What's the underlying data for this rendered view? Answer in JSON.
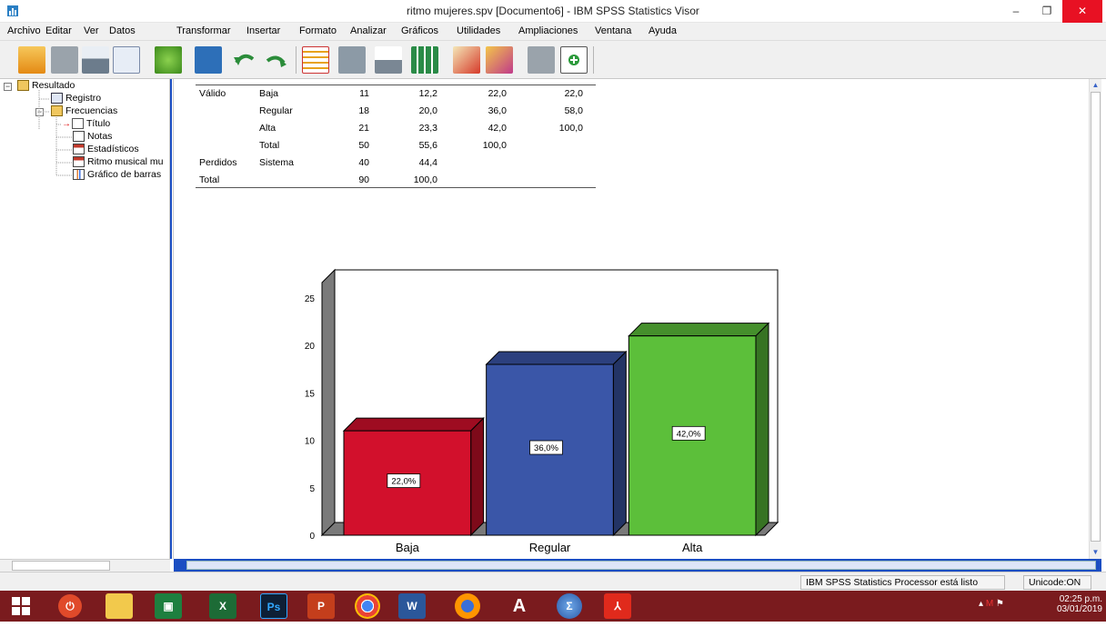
{
  "window": {
    "title": "ritmo mujeres.spv [Documento6] - IBM SPSS Statistics Visor",
    "minimize": "–",
    "restore": "❐",
    "close": "✕"
  },
  "menu": [
    "Archivo",
    "Editar",
    "Ver",
    "Datos",
    "Transformar",
    "Insertar",
    "Formato",
    "Analizar",
    "Gráficos",
    "Utilidades",
    "Ampliaciones",
    "Ventana",
    "Ayuda"
  ],
  "toolbar_icons": [
    "open-icon",
    "save-icon",
    "print-icon",
    "print-preview-icon",
    "export-icon",
    "recall-dialog-icon",
    "undo-icon",
    "redo-icon",
    "goto-data-icon",
    "goto-case-icon",
    "goto-variable-icon",
    "variables-icon",
    "designate-window-icon",
    "create-edit-autoscript-icon",
    "select-last-output-icon",
    "show-all-icon"
  ],
  "outline": {
    "items": [
      {
        "label": "Resultado",
        "icon": "book-icon"
      },
      {
        "label": "Registro",
        "icon": "log-icon"
      },
      {
        "label": "Frecuencias",
        "icon": "book-icon"
      },
      {
        "label": "Título",
        "icon": "title-icon"
      },
      {
        "label": "Notas",
        "icon": "notes-icon"
      },
      {
        "label": "Estadísticos",
        "icon": "table-icon"
      },
      {
        "label": "Ritmo musical mu",
        "icon": "table-icon"
      },
      {
        "label": "Gráfico de barras",
        "icon": "chart-icon"
      }
    ]
  },
  "frequency_table": {
    "rows": [
      {
        "group": "Válido",
        "label": "Baja",
        "freq": "11",
        "pct": "12,2",
        "valid_pct": "22,0",
        "cum_pct": "22,0"
      },
      {
        "group": "",
        "label": "Regular",
        "freq": "18",
        "pct": "20,0",
        "valid_pct": "36,0",
        "cum_pct": "58,0"
      },
      {
        "group": "",
        "label": "Alta",
        "freq": "21",
        "pct": "23,3",
        "valid_pct": "42,0",
        "cum_pct": "100,0"
      },
      {
        "group": "",
        "label": "Total",
        "freq": "50",
        "pct": "55,6",
        "valid_pct": "100,0",
        "cum_pct": ""
      },
      {
        "group": "Perdidos",
        "label": "Sistema",
        "freq": "40",
        "pct": "44,4",
        "valid_pct": "",
        "cum_pct": ""
      },
      {
        "group": "Total",
        "label": "",
        "freq": "90",
        "pct": "100,0",
        "valid_pct": "",
        "cum_pct": ""
      }
    ]
  },
  "chart_data": {
    "type": "bar",
    "categories": [
      "Baja",
      "Regular",
      "Alta"
    ],
    "values": [
      11,
      18,
      21
    ],
    "data_labels": [
      "22,0%",
      "36,0%",
      "42,0%"
    ],
    "colors": [
      "#d2102c",
      "#3a56a8",
      "#5cbf3a"
    ],
    "ylim": [
      0,
      27
    ],
    "yticks": [
      0,
      5,
      10,
      15,
      20,
      25
    ],
    "title": "",
    "xlabel": "",
    "ylabel": "",
    "style": "3d"
  },
  "status": {
    "processor": "IBM SPSS Statistics Processor está listo",
    "unicode": "Unicode:ON"
  },
  "taskbar": {
    "time": "02:25 p.m.",
    "date": "03/01/2019",
    "apps": [
      "windows-start-icon",
      "power-icon",
      "file-explorer-icon",
      "store-icon",
      "excel-icon",
      "photoshop-icon",
      "powerpoint-icon",
      "chrome-icon",
      "word-icon",
      "firefox-icon",
      "font-icon",
      "spss-icon",
      "acrobat-icon"
    ]
  }
}
